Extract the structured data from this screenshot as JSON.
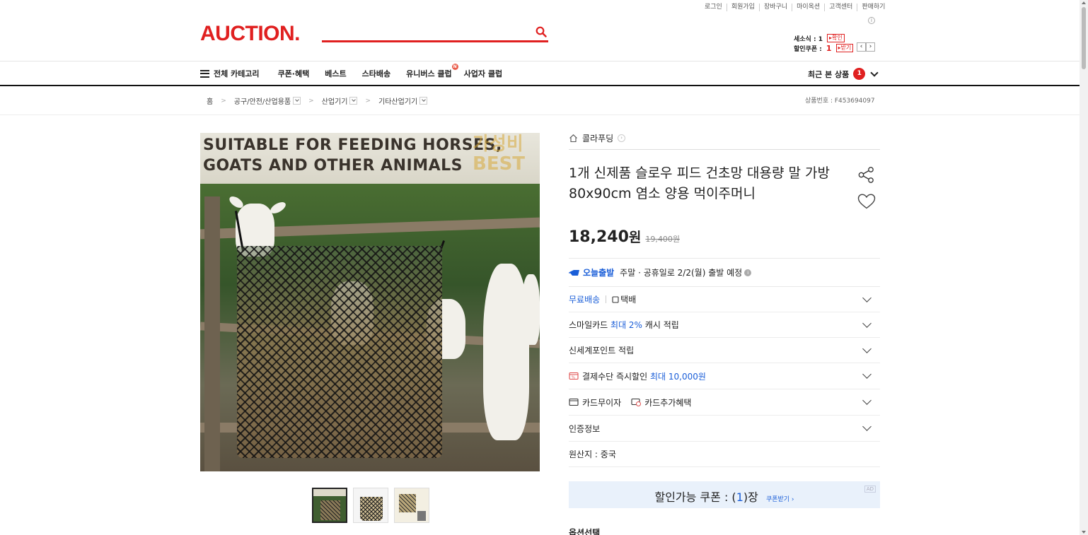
{
  "header": {
    "utility_links": [
      "로그인",
      "회원가입",
      "장바구니",
      "마이옥션",
      "고객센터",
      "판매하기"
    ],
    "logo": "AUCTION.",
    "search_placeholder": "",
    "mini_info": {
      "cart_label": "세소식 : 1",
      "cart_action": "확인",
      "coupon_label": "할인쿠폰 :",
      "coupon_count": "1",
      "coupon_action": "받기"
    }
  },
  "nav": {
    "all_categories": "전체 카테고리",
    "items": [
      "쿠폰·혜택",
      "베스트",
      "스타배송",
      "유니버스 클럽",
      "사업자 클럽"
    ],
    "new_badge": "N",
    "recent_label": "최근 본 상품",
    "recent_count": "1"
  },
  "breadcrumb": {
    "items": [
      "홈",
      "공구/안전/산업용품",
      "산업기기",
      "기타산업기기"
    ],
    "product_no": "상품번호 : F453694097"
  },
  "product": {
    "image_text_line1": "SUITABLE FOR FEEDING HORSES,",
    "image_text_line2": "GOATS AND OTHER ANIMALS",
    "image_watermark": "가성비 BEST",
    "brand": "콜라푸딩",
    "title": "1개 신제품 슬로우 피드 건초망 대용량 말 가방 80x90cm 염소 양용 먹이주머니",
    "price": "18,240",
    "price_unit": "원",
    "original_price": "19,400원",
    "ship_today_label": "오늘출발",
    "ship_today_desc": "주말 · 공휴일로 2/2(월) 출발 예정",
    "rows": {
      "free_shipping": "무료배송",
      "courier": "택배",
      "smilecard_prefix": "스마일카드",
      "smilecard_highlight": "최대 2%",
      "smilecard_suffix": "캐시 적립",
      "shinsegae": "신세계포인트 적립",
      "payment_prefix": "결제수단 즉시할인",
      "payment_highlight": "최대 10,000원",
      "card_installment": "카드무이자",
      "card_benefit": "카드추가혜택",
      "certification": "인증정보",
      "origin": "원산지 : 중국"
    },
    "coupon_prefix": "할인가능 쿠폰 : (",
    "coupon_count": "1",
    "coupon_suffix": ")장",
    "coupon_get": "쿠폰받기 ›",
    "ad_tag": "AD",
    "option_label": "옵션선택"
  }
}
